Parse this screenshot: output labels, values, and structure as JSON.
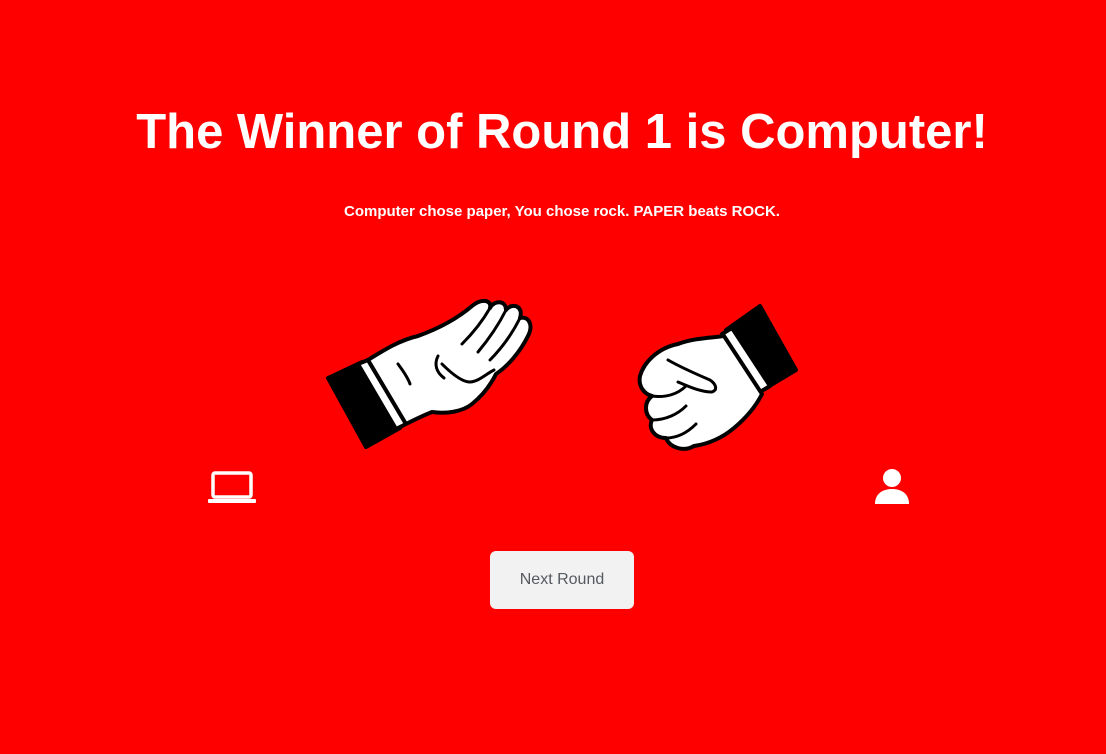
{
  "result": {
    "headline": "The Winner of Round 1 is Computer!",
    "summary": "Computer chose paper, You chose rock. PAPER beats ROCK."
  },
  "hands": {
    "computer_choice_icon": "paper-hand-icon",
    "player_choice_icon": "rock-fist-icon"
  },
  "players": {
    "computer_icon": "laptop-icon",
    "player_icon": "user-icon"
  },
  "controls": {
    "next_round_label": "Next Round"
  },
  "colors": {
    "background": "#ff0000",
    "text": "#ffffff",
    "button_bg": "#f2f2f2",
    "button_text": "#555a60"
  }
}
